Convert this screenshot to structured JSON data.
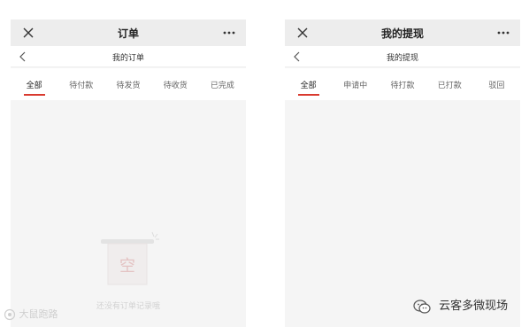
{
  "left_screen": {
    "window_title": "订单",
    "page_title": "我的订单",
    "tabs": [
      "全部",
      "待付款",
      "待发货",
      "待收货",
      "已完成"
    ],
    "active_tab_index": 0,
    "empty_state": {
      "illustration_glyph": "空",
      "message": "还没有订单记录哦"
    }
  },
  "right_screen": {
    "window_title": "我的提现",
    "page_title": "我的提现",
    "tabs": [
      "全部",
      "申请中",
      "待打款",
      "已打款",
      "驳回"
    ],
    "active_tab_index": 0
  },
  "watermarks": {
    "left_text": "大鼠跑路",
    "right_text": "云客多微现场"
  },
  "icons": {
    "close": "close-icon",
    "more": "more-dots-icon",
    "back": "chevron-left-icon"
  },
  "colors": {
    "accent": "#d93a2f",
    "titlebar_bg": "#ededed",
    "content_bg": "#f5f5f5"
  }
}
